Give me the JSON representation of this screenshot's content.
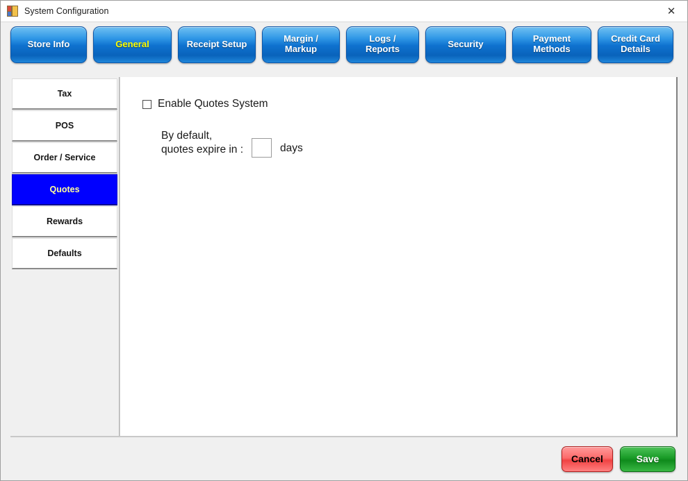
{
  "window": {
    "title": "System Configuration",
    "icon": "windows-form-icon",
    "close_label": "✕"
  },
  "tabs": [
    {
      "label": "Store Info",
      "active": false
    },
    {
      "label": "General",
      "active": true
    },
    {
      "label": "Receipt Setup",
      "active": false
    },
    {
      "label": "Margin /\nMarkup",
      "active": false
    },
    {
      "label": "Logs /\nReports",
      "active": false
    },
    {
      "label": "Security",
      "active": false
    },
    {
      "label": "Payment\nMethods",
      "active": false
    },
    {
      "label": "Credit Card\nDetails",
      "active": false
    }
  ],
  "sidebar": {
    "items": [
      {
        "label": "Tax",
        "selected": false
      },
      {
        "label": "POS",
        "selected": false
      },
      {
        "label": "Order / Service",
        "selected": false
      },
      {
        "label": "Quotes",
        "selected": true
      },
      {
        "label": "Rewards",
        "selected": false
      },
      {
        "label": "Defaults",
        "selected": false
      }
    ]
  },
  "main": {
    "enable_quotes_label": "Enable Quotes System",
    "enable_quotes_checked": false,
    "expire_label": "By default,\nquotes expire in :",
    "expire_value": "",
    "expire_placeholder": "",
    "days_unit": "days"
  },
  "footer": {
    "cancel_label": "Cancel",
    "save_label": "Save"
  },
  "colors": {
    "tab_blue": "#0f72cf",
    "tab_active_text": "#ffff00",
    "sidebar_selected_bg": "#0000ff",
    "sidebar_selected_text": "#ffff99",
    "cancel_red": "#f04343",
    "save_green": "#199b27"
  }
}
